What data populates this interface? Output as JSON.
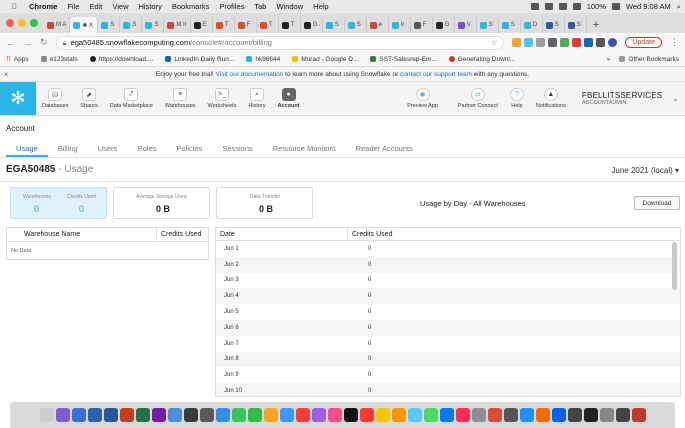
{
  "menubar": {
    "apple": "",
    "items": [
      "Chrome",
      "File",
      "Edit",
      "View",
      "History",
      "Bookmarks",
      "Profiles",
      "Tab",
      "Window",
      "Help"
    ],
    "battery": "100%",
    "clock": "Wed 9:08 AM"
  },
  "tabs": [
    {
      "label": "M A",
      "color": "#d44638"
    },
    {
      "label": "✱ X",
      "color": "#29b5e8",
      "active": true
    },
    {
      "label": "S",
      "color": "#29b5e8"
    },
    {
      "label": "S",
      "color": "#29b5e8"
    },
    {
      "label": "S",
      "color": "#29b5e8"
    },
    {
      "label": "M Ir",
      "color": "#d44638"
    },
    {
      "label": "E",
      "color": "#222"
    },
    {
      "label": "T",
      "color": "#e44d26"
    },
    {
      "label": "F",
      "color": "#e44d26"
    },
    {
      "label": "T",
      "color": "#e44d26"
    },
    {
      "label": "T",
      "color": "#222"
    },
    {
      "label": "G",
      "color": "#222"
    },
    {
      "label": "S",
      "color": "#29b5e8"
    },
    {
      "label": "S",
      "color": "#29b5e8"
    },
    {
      "label": "e",
      "color": "#d44638"
    },
    {
      "label": "Ir",
      "color": "#29b5e8"
    },
    {
      "label": "F",
      "color": "#555"
    },
    {
      "label": "G",
      "color": "#222"
    },
    {
      "label": "V",
      "color": "#7a4bd6"
    },
    {
      "label": "S",
      "color": "#29b5e8"
    },
    {
      "label": "S",
      "color": "#29b5e8"
    },
    {
      "label": "D",
      "color": "#29b5e8"
    },
    {
      "label": "S",
      "color": "#2e5aac"
    },
    {
      "label": "S",
      "color": "#2e5aac"
    }
  ],
  "newtab": "+",
  "address": {
    "host": "ega50485.snowflakecomputing.com",
    "path": "/console#/account/billing",
    "update": "Update"
  },
  "bookmarks": [
    "Apps",
    "e123stats",
    "https://download....",
    "LinkedIn Daily Run...",
    "hk96644",
    "Murad - Google D...",
    "SST-Salesrep-Em...",
    "Generating Downl..."
  ],
  "other_bookmarks": "Other Bookmarks",
  "banner": {
    "pre": "Enjoy your free trial! ",
    "link1": "Visit our documentation",
    "mid": " to learn more about using Snowflake or ",
    "link2": "contact our support team",
    "post": " with any questions.",
    "close": "×"
  },
  "sfnav": {
    "items": [
      {
        "label": "Databases",
        "icon": "⛁"
      },
      {
        "label": "Shares",
        "icon": "⬈"
      },
      {
        "label": "Data Marketplace",
        "icon": "⤤"
      },
      {
        "label": "Warehouses",
        "icon": "≡"
      },
      {
        "label": "Worksheets",
        "icon": ">_"
      },
      {
        "label": "History",
        "icon": "⌕"
      },
      {
        "label": "Account",
        "icon": "●",
        "active": true
      }
    ],
    "right": [
      {
        "label": "Preview App",
        "icon": "✱"
      },
      {
        "label": "Partner Connect",
        "icon": "⇄"
      },
      {
        "label": "Help",
        "icon": "?"
      },
      {
        "label": "Notifications",
        "icon": "▲"
      }
    ],
    "account_name": "FBELLITSSERVICES",
    "account_role": "ACCOUNTADMIN"
  },
  "page": {
    "title": "Account",
    "subtabs": [
      "Usage",
      "Billing",
      "Users",
      "Roles",
      "Policies",
      "Sessions",
      "Resource Monitors",
      "Reader Accounts"
    ],
    "account_id": "EGA50485",
    "account_sub": " - Usage",
    "period": "June 2021 (local) ▾"
  },
  "cards": {
    "warehouses_label": "Warehouses",
    "warehouses_value": "0",
    "credits_label": "Credits Used",
    "credits_value": "0",
    "storage_label": "Average Storage Used",
    "storage_value": "0 B",
    "transfer_label": "Data Transfer",
    "transfer_value": "0 B"
  },
  "usage_title": "Usage by Day - All Warehouses",
  "download": "Download",
  "left_table": {
    "col1": "Warehouse Name",
    "col2": "Credits Used",
    "empty": "No Data"
  },
  "right_table": {
    "col1": "Date",
    "col2": "Credits Used",
    "rows": [
      {
        "date": "Jun 1",
        "credits": "0"
      },
      {
        "date": "Jun 2",
        "credits": "0"
      },
      {
        "date": "Jun 3",
        "credits": "0"
      },
      {
        "date": "Jun 4",
        "credits": "0"
      },
      {
        "date": "Jun 5",
        "credits": "0"
      },
      {
        "date": "Jun 6",
        "credits": "0"
      },
      {
        "date": "Jun 7",
        "credits": "0"
      },
      {
        "date": "Jun 8",
        "credits": "0"
      },
      {
        "date": "Jun 9",
        "credits": "0"
      },
      {
        "date": "Jun 10",
        "credits": "0"
      }
    ]
  },
  "dock_colors": [
    "#ccc",
    "#7b5cd6",
    "#3a6fd8",
    "#2f5fb3",
    "#2b579a",
    "#c43e1c",
    "#217346",
    "#7719aa",
    "#4a90d9",
    "#3c3c3c",
    "#5a5a5a",
    "#2f8ee5",
    "#3ac15a",
    "#2fbd4a",
    "#f5a623",
    "#3b99fc",
    "#fc3d39",
    "#9c5de8",
    "#fa4b8d",
    "#111",
    "#ff3b30",
    "#f7c600",
    "#ff9500",
    "#5ac8fa",
    "#4cd964",
    "#007aff",
    "#ff2d55",
    "#8e8e93",
    "#dd4b39",
    "#555",
    "#1e90ff",
    "#ff6a00",
    "#0061fe",
    "#444",
    "#222",
    "#888",
    "#444",
    "#c0392b"
  ]
}
